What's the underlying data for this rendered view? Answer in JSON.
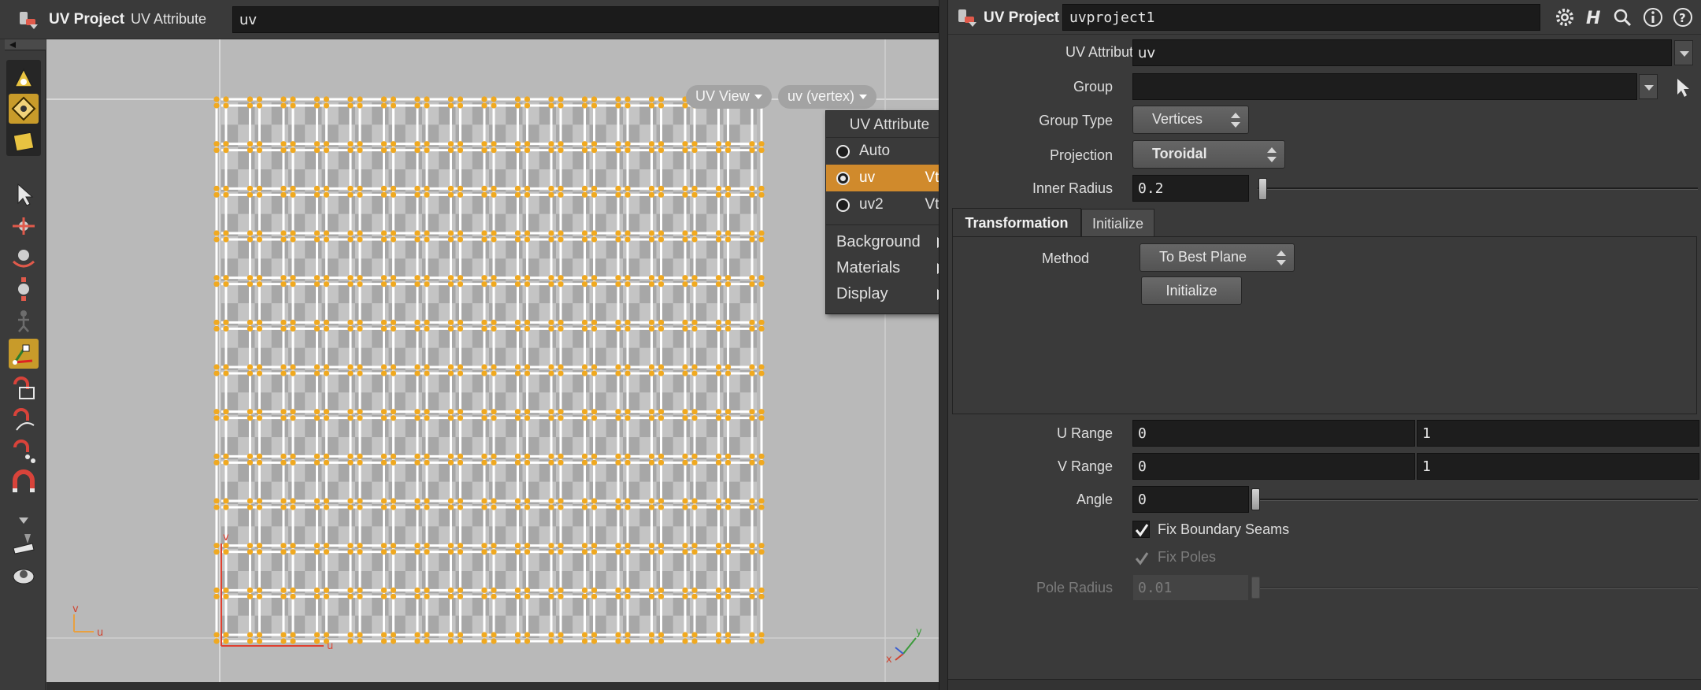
{
  "left_pane": {
    "title": "UV Project",
    "attr_label": "UV Attribute",
    "attr_value": "uv"
  },
  "viewport": {
    "view_pill": "UV View",
    "attr_pill": "uv (vertex)",
    "axis_v": "v",
    "axis_u": "u",
    "uv_origin_v": "v",
    "uv_origin_u": "u",
    "gizmo_y": "y",
    "gizmo_x": "x",
    "grid_colors": {
      "background": "#b9b9b9",
      "checker_light": "#c4c4c4",
      "checker_dark": "#a7a7a7",
      "edge": "#ffffff",
      "point": "#f0a920",
      "origin_axis": "#e04030"
    }
  },
  "uv_menu": {
    "header": "UV Attribute",
    "options": [
      {
        "label": "Auto",
        "tag": "",
        "selected": false
      },
      {
        "label": "uv",
        "tag": "Vtx",
        "selected": true
      },
      {
        "label": "uv2",
        "tag": "Vtx",
        "selected": false
      }
    ],
    "submenus": [
      "Background",
      "Materials",
      "Display"
    ]
  },
  "toolbar": {
    "tools": [
      "uv-paint-icon",
      "uv-flatten-icon",
      "uv-layout-icon",
      "select-arrow-icon",
      "move-icon",
      "rotate-icon",
      "scale-icon",
      "pose-icon",
      "handle-icon",
      "magnet-box-icon",
      "magnet-curve-icon",
      "magnet-points-icon",
      "magnet-icon",
      "more-tools-icon",
      "stamp-icon",
      "render-icon"
    ]
  },
  "params": {
    "node_type": "UV Project",
    "node_name": "uvproject1",
    "uv_attribute_label": "UV Attribute",
    "uv_attribute_value": "uv",
    "group_label": "Group",
    "group_value": "",
    "group_type_label": "Group Type",
    "group_type_value": "Vertices",
    "projection_label": "Projection",
    "projection_value": "Toroidal",
    "inner_radius_label": "Inner Radius",
    "inner_radius_value": "0.2",
    "tabs": [
      "Transformation",
      "Initialize"
    ],
    "method_label": "Method",
    "method_value": "To Best Plane",
    "initialize_button": "Initialize",
    "u_range_label": "U Range",
    "u_range_min": "0",
    "u_range_max": "1",
    "v_range_label": "V Range",
    "v_range_min": "0",
    "v_range_max": "1",
    "angle_label": "Angle",
    "angle_value": "0",
    "fix_seams_label": "Fix Boundary Seams",
    "fix_seams_checked": true,
    "fix_poles_label": "Fix Poles",
    "fix_poles_checked": true,
    "pole_radius_label": "Pole Radius",
    "pole_radius_value": "0.01"
  },
  "colors": {
    "accent": "#d08a2c",
    "active_tool": "#c89b2a",
    "panel": "#3a3a3a",
    "field": "#1d1d1d"
  }
}
